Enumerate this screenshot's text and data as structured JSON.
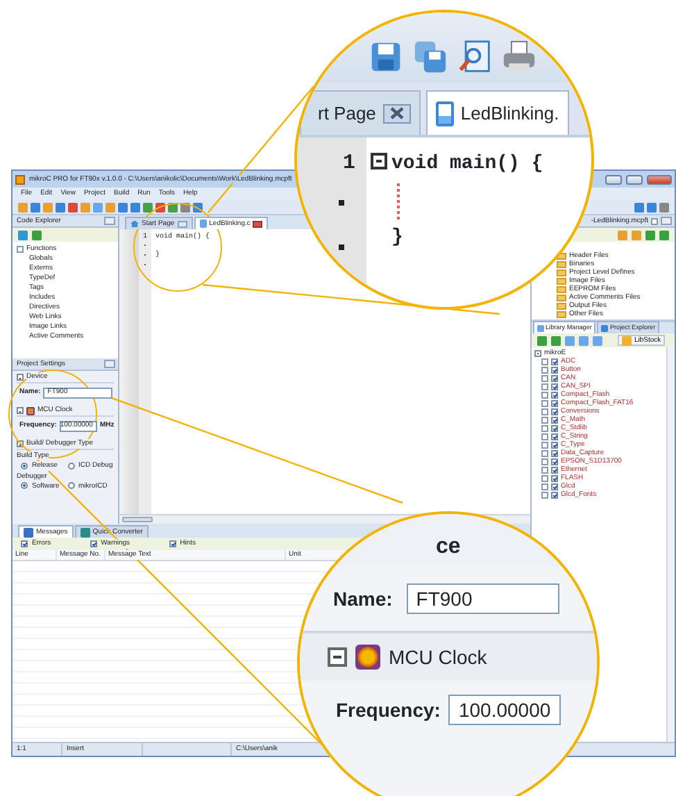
{
  "window": {
    "title": "mikroC PRO for FT90x v.1.0.0 - C:\\Users\\anikolic\\Documents\\Work\\LedBlinking.mcpft",
    "menu": [
      "File",
      "Edit",
      "View",
      "Project",
      "Build",
      "Run",
      "Tools",
      "Help"
    ]
  },
  "code_explorer": {
    "title": "Code Explorer",
    "items": [
      {
        "label": "Functions",
        "expandable": true
      },
      {
        "label": "Globals",
        "expandable": false
      },
      {
        "label": "Externs",
        "expandable": false
      },
      {
        "label": "TypeDef",
        "expandable": false
      },
      {
        "label": "Tags",
        "expandable": false
      },
      {
        "label": "Includes",
        "expandable": false
      },
      {
        "label": "Directives",
        "expandable": false
      },
      {
        "label": "Web Links",
        "expandable": false
      },
      {
        "label": "Image Links",
        "expandable": false
      },
      {
        "label": "Active Comments",
        "expandable": false
      }
    ]
  },
  "project_settings": {
    "title": "Project Settings",
    "device_header": "Device",
    "name_label": "Name:",
    "name_value": "FT900",
    "clock_header": "MCU Clock",
    "frequency_label": "Frequency:",
    "frequency_value": "100.00000",
    "frequency_unit": "MHz",
    "build_header": "Build/ Debugger Type",
    "build_type_label": "Build Type",
    "build_type_options": [
      {
        "label": "Release",
        "selected": true
      },
      {
        "label": "ICD Debug",
        "selected": false
      }
    ],
    "debugger_label": "Debugger",
    "debugger_options": [
      {
        "label": "Software",
        "selected": true
      },
      {
        "label": "mikroICD",
        "selected": false
      }
    ]
  },
  "editor": {
    "tabs": [
      {
        "label": "Start Page",
        "selected": false
      },
      {
        "label": "LedBlinking.c",
        "selected": true
      }
    ],
    "line_number": "1",
    "code": [
      "void main() {",
      "}"
    ]
  },
  "project_manager": {
    "title": "-LedBlinking.mcpft",
    "items": [
      "Header Files",
      "Binaries",
      "Project Level Defines",
      "Image Files",
      "EEPROM Files",
      "Active Comments Files",
      "Output Files",
      "Other Files"
    ]
  },
  "library_manager": {
    "tabs": [
      {
        "label": "Library Manager",
        "selected": true
      },
      {
        "label": "Project Explorer",
        "selected": false
      }
    ],
    "libstock": "LibStock",
    "root": "mikroE",
    "items": [
      {
        "name": "ADC",
        "checked": true
      },
      {
        "name": "Button",
        "checked": true
      },
      {
        "name": "CAN",
        "checked": true
      },
      {
        "name": "CAN_SPI",
        "checked": true
      },
      {
        "name": "Compact_Flash",
        "checked": true
      },
      {
        "name": "Compact_Flash_FAT16",
        "checked": true
      },
      {
        "name": "Conversions",
        "checked": true
      },
      {
        "name": "C_Math",
        "checked": true
      },
      {
        "name": "C_Stdlib",
        "checked": true
      },
      {
        "name": "C_String",
        "checked": true
      },
      {
        "name": "C_Type",
        "checked": true
      },
      {
        "name": "Data_Capture",
        "checked": true
      },
      {
        "name": "EPSON_S1D13700",
        "checked": true
      },
      {
        "name": "Ethernet",
        "checked": true
      },
      {
        "name": "FLASH",
        "checked": true
      },
      {
        "name": "Glcd",
        "checked": true
      },
      {
        "name": "Glcd_Fonts",
        "checked": true
      }
    ]
  },
  "messages": {
    "tabs": [
      {
        "label": "Messages",
        "selected": true
      },
      {
        "label": "Quick Converter",
        "selected": false
      }
    ],
    "filters": [
      {
        "label": "Errors",
        "checked": true
      },
      {
        "label": "Warnings",
        "checked": true
      },
      {
        "label": "Hints",
        "checked": true
      }
    ],
    "columns": [
      "Line",
      "Message No.",
      "Message Text",
      "Unit"
    ]
  },
  "status_bar": [
    "1:1",
    "Insert",
    "C:\\Users\\anik"
  ],
  "magnifier_top": {
    "tabs": [
      {
        "label": "rt Page",
        "selected": false
      },
      {
        "label": "LedBlinking.",
        "selected": true
      }
    ],
    "line_number": "1",
    "code": [
      "void main() {",
      "}"
    ]
  },
  "magnifier_bottom": {
    "section": "ce",
    "name_label": "Name:",
    "name_value": "FT900",
    "clock_header": "MCU Clock",
    "frequency_label": "Frequency:",
    "frequency_value": "100.00000"
  }
}
